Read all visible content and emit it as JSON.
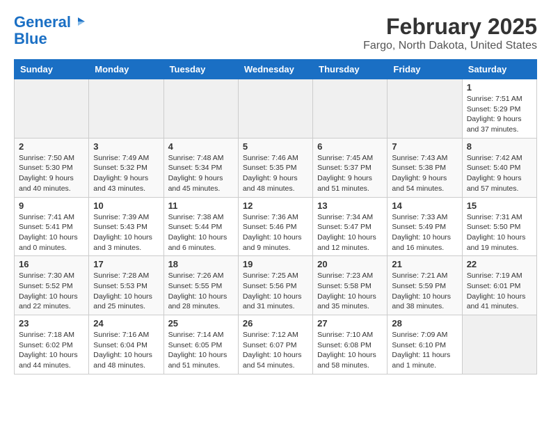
{
  "logo": {
    "line1": "General",
    "line2": "Blue"
  },
  "title": "February 2025",
  "subtitle": "Fargo, North Dakota, United States",
  "weekdays": [
    "Sunday",
    "Monday",
    "Tuesday",
    "Wednesday",
    "Thursday",
    "Friday",
    "Saturday"
  ],
  "weeks": [
    [
      {
        "day": "",
        "info": ""
      },
      {
        "day": "",
        "info": ""
      },
      {
        "day": "",
        "info": ""
      },
      {
        "day": "",
        "info": ""
      },
      {
        "day": "",
        "info": ""
      },
      {
        "day": "",
        "info": ""
      },
      {
        "day": "1",
        "info": "Sunrise: 7:51 AM\nSunset: 5:29 PM\nDaylight: 9 hours\nand 37 minutes."
      }
    ],
    [
      {
        "day": "2",
        "info": "Sunrise: 7:50 AM\nSunset: 5:30 PM\nDaylight: 9 hours\nand 40 minutes."
      },
      {
        "day": "3",
        "info": "Sunrise: 7:49 AM\nSunset: 5:32 PM\nDaylight: 9 hours\nand 43 minutes."
      },
      {
        "day": "4",
        "info": "Sunrise: 7:48 AM\nSunset: 5:34 PM\nDaylight: 9 hours\nand 45 minutes."
      },
      {
        "day": "5",
        "info": "Sunrise: 7:46 AM\nSunset: 5:35 PM\nDaylight: 9 hours\nand 48 minutes."
      },
      {
        "day": "6",
        "info": "Sunrise: 7:45 AM\nSunset: 5:37 PM\nDaylight: 9 hours\nand 51 minutes."
      },
      {
        "day": "7",
        "info": "Sunrise: 7:43 AM\nSunset: 5:38 PM\nDaylight: 9 hours\nand 54 minutes."
      },
      {
        "day": "8",
        "info": "Sunrise: 7:42 AM\nSunset: 5:40 PM\nDaylight: 9 hours\nand 57 minutes."
      }
    ],
    [
      {
        "day": "9",
        "info": "Sunrise: 7:41 AM\nSunset: 5:41 PM\nDaylight: 10 hours\nand 0 minutes."
      },
      {
        "day": "10",
        "info": "Sunrise: 7:39 AM\nSunset: 5:43 PM\nDaylight: 10 hours\nand 3 minutes."
      },
      {
        "day": "11",
        "info": "Sunrise: 7:38 AM\nSunset: 5:44 PM\nDaylight: 10 hours\nand 6 minutes."
      },
      {
        "day": "12",
        "info": "Sunrise: 7:36 AM\nSunset: 5:46 PM\nDaylight: 10 hours\nand 9 minutes."
      },
      {
        "day": "13",
        "info": "Sunrise: 7:34 AM\nSunset: 5:47 PM\nDaylight: 10 hours\nand 12 minutes."
      },
      {
        "day": "14",
        "info": "Sunrise: 7:33 AM\nSunset: 5:49 PM\nDaylight: 10 hours\nand 16 minutes."
      },
      {
        "day": "15",
        "info": "Sunrise: 7:31 AM\nSunset: 5:50 PM\nDaylight: 10 hours\nand 19 minutes."
      }
    ],
    [
      {
        "day": "16",
        "info": "Sunrise: 7:30 AM\nSunset: 5:52 PM\nDaylight: 10 hours\nand 22 minutes."
      },
      {
        "day": "17",
        "info": "Sunrise: 7:28 AM\nSunset: 5:53 PM\nDaylight: 10 hours\nand 25 minutes."
      },
      {
        "day": "18",
        "info": "Sunrise: 7:26 AM\nSunset: 5:55 PM\nDaylight: 10 hours\nand 28 minutes."
      },
      {
        "day": "19",
        "info": "Sunrise: 7:25 AM\nSunset: 5:56 PM\nDaylight: 10 hours\nand 31 minutes."
      },
      {
        "day": "20",
        "info": "Sunrise: 7:23 AM\nSunset: 5:58 PM\nDaylight: 10 hours\nand 35 minutes."
      },
      {
        "day": "21",
        "info": "Sunrise: 7:21 AM\nSunset: 5:59 PM\nDaylight: 10 hours\nand 38 minutes."
      },
      {
        "day": "22",
        "info": "Sunrise: 7:19 AM\nSunset: 6:01 PM\nDaylight: 10 hours\nand 41 minutes."
      }
    ],
    [
      {
        "day": "23",
        "info": "Sunrise: 7:18 AM\nSunset: 6:02 PM\nDaylight: 10 hours\nand 44 minutes."
      },
      {
        "day": "24",
        "info": "Sunrise: 7:16 AM\nSunset: 6:04 PM\nDaylight: 10 hours\nand 48 minutes."
      },
      {
        "day": "25",
        "info": "Sunrise: 7:14 AM\nSunset: 6:05 PM\nDaylight: 10 hours\nand 51 minutes."
      },
      {
        "day": "26",
        "info": "Sunrise: 7:12 AM\nSunset: 6:07 PM\nDaylight: 10 hours\nand 54 minutes."
      },
      {
        "day": "27",
        "info": "Sunrise: 7:10 AM\nSunset: 6:08 PM\nDaylight: 10 hours\nand 58 minutes."
      },
      {
        "day": "28",
        "info": "Sunrise: 7:09 AM\nSunset: 6:10 PM\nDaylight: 11 hours\nand 1 minute."
      },
      {
        "day": "",
        "info": ""
      }
    ]
  ]
}
